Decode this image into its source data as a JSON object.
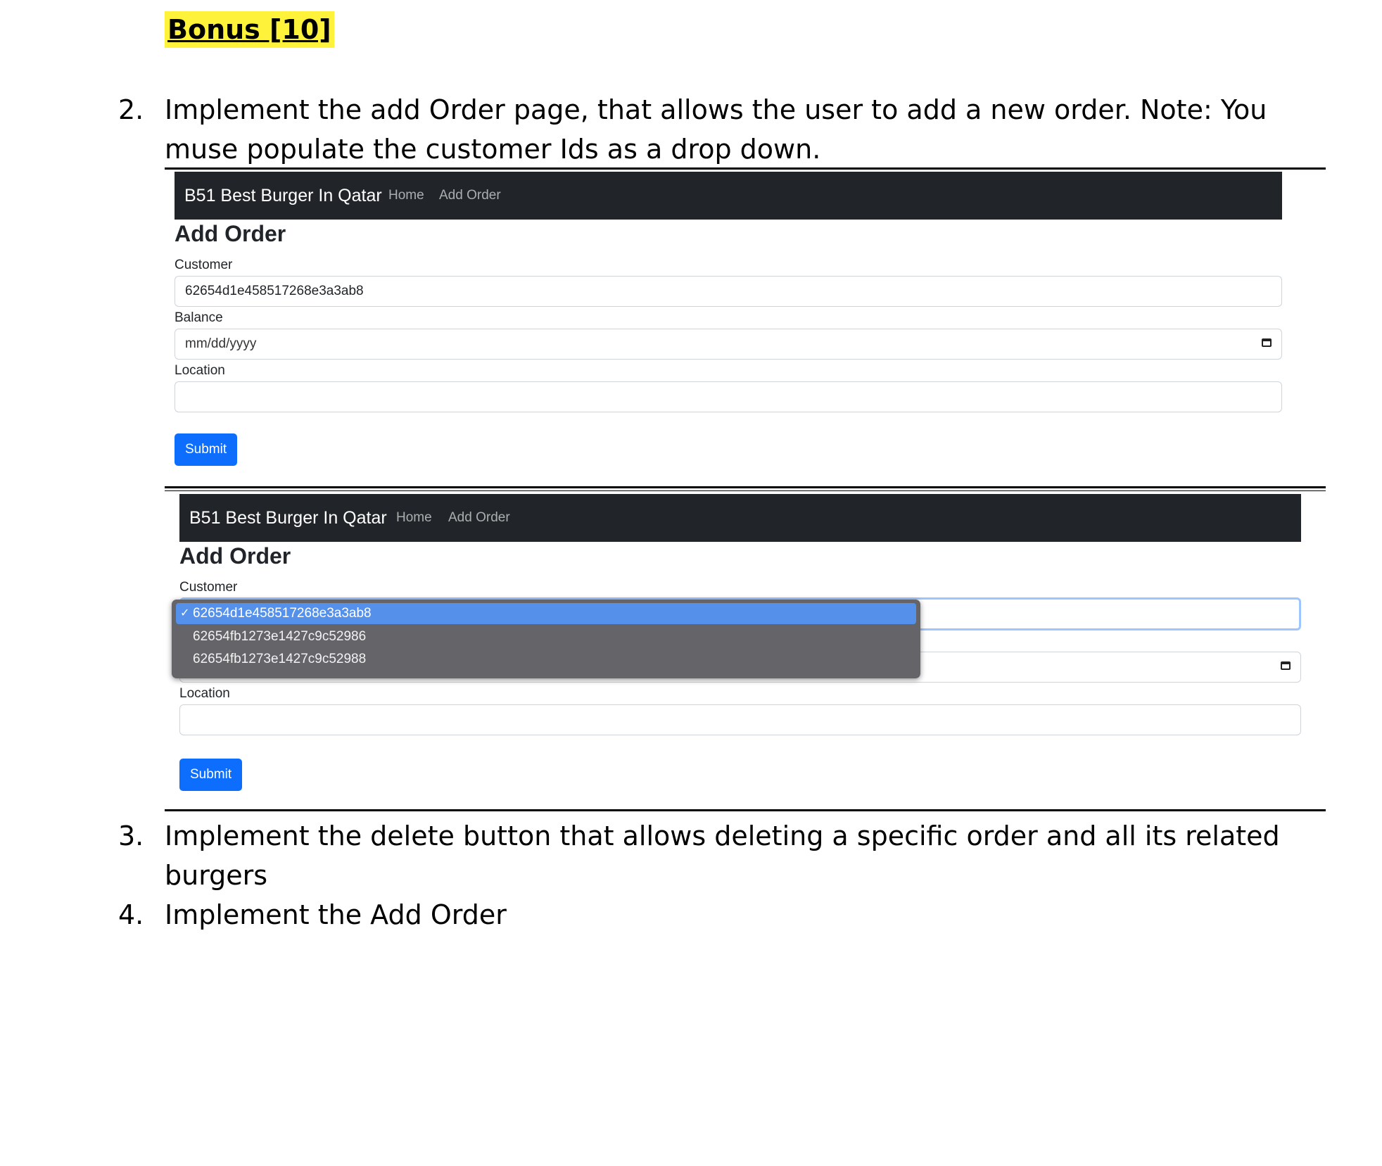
{
  "bonus_heading": "Bonus [10]",
  "items": [
    {
      "number": "2.",
      "line1": "Implement the add Order page, that allows the user to add a new order. Note: You",
      "line2": "muse populate the customer Ids as a drop down."
    },
    {
      "number": "3.",
      "line1": "Implement the delete button that allows deleting a specific order and all its related",
      "line2": "burgers"
    },
    {
      "number": "4.",
      "line1": "Implement the Add Order"
    }
  ],
  "app": {
    "brand": "B51 Best Burger In Qatar",
    "nav": [
      "Home",
      "Add Order"
    ],
    "page_title": "Add Order",
    "form": {
      "customer_label": "Customer",
      "balance_label": "Balance",
      "location_label": "Location",
      "submit_label": "Submit"
    }
  },
  "screenshot1": {
    "customer_value": "62654d1e458517268e3a3ab8",
    "balance_placeholder": "mm/dd/yyyy",
    "location_value": ""
  },
  "screenshot2": {
    "dropdown_options": [
      {
        "value": "62654d1e458517268e3a3ab8",
        "selected": true
      },
      {
        "value": "62654fb1273e1427c9c52986",
        "selected": false
      },
      {
        "value": "62654fb1273e1427c9c52988",
        "selected": false
      }
    ],
    "check_mark": "✓"
  },
  "colors": {
    "highlight": "#fff23a",
    "navbar": "#212529",
    "primary": "#0d6efd",
    "dropdown_bg": "#656569",
    "dropdown_selected": "#5590ea"
  }
}
